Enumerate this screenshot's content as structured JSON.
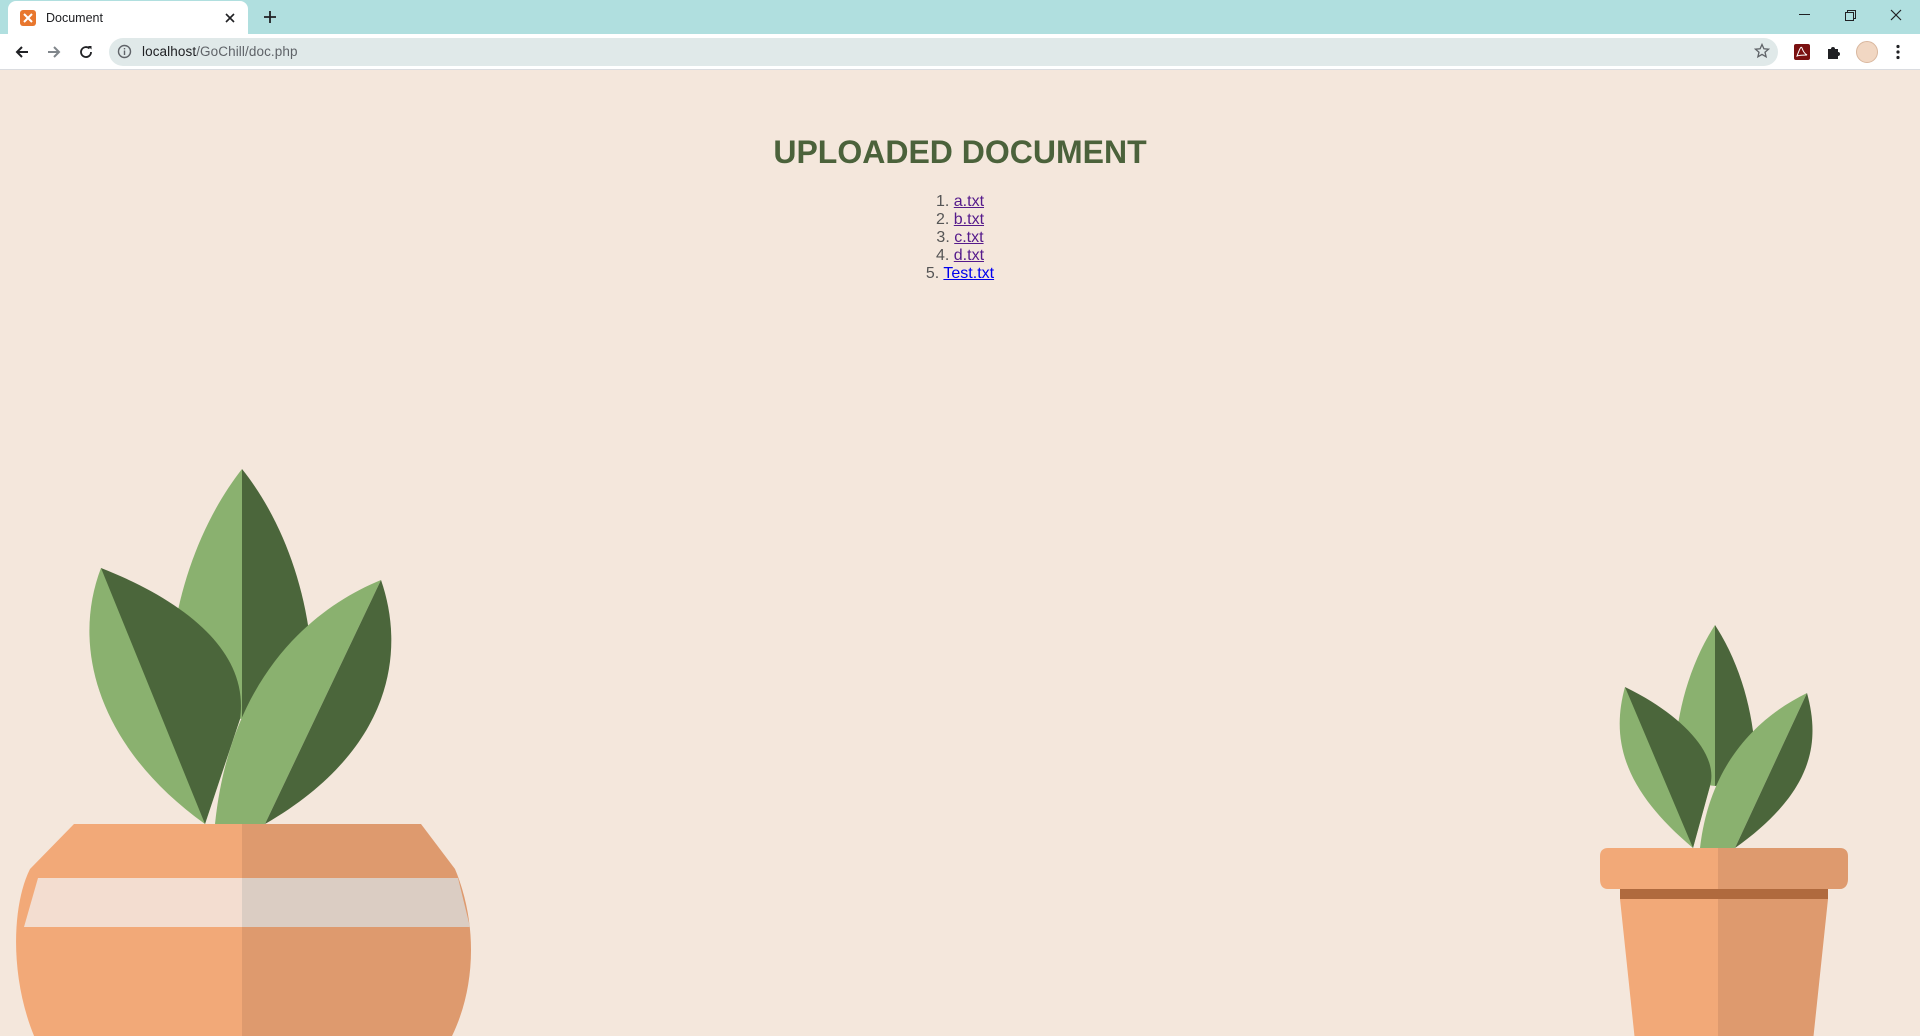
{
  "browser": {
    "tab_title": "Document",
    "url_host": "localhost",
    "url_path": "/GoChill/doc.php"
  },
  "page": {
    "heading": "UPLOADED DOCUMENT",
    "documents": [
      {
        "number": "1.",
        "name": "a.txt",
        "visited": true
      },
      {
        "number": "2.",
        "name": "b.txt",
        "visited": true
      },
      {
        "number": "3.",
        "name": "c.txt",
        "visited": true
      },
      {
        "number": "4.",
        "name": "d.txt",
        "visited": true
      },
      {
        "number": "5.",
        "name": "Test.txt",
        "visited": false
      }
    ]
  },
  "colors": {
    "page_background": "#f4e7dc",
    "heading": "#4b623b",
    "tab_strip": "#b0dfdf",
    "leaf_light": "#8ab16f",
    "leaf_dark": "#4b663b",
    "pot_light": "#f2a978",
    "pot_dark": "#de9a6e"
  }
}
